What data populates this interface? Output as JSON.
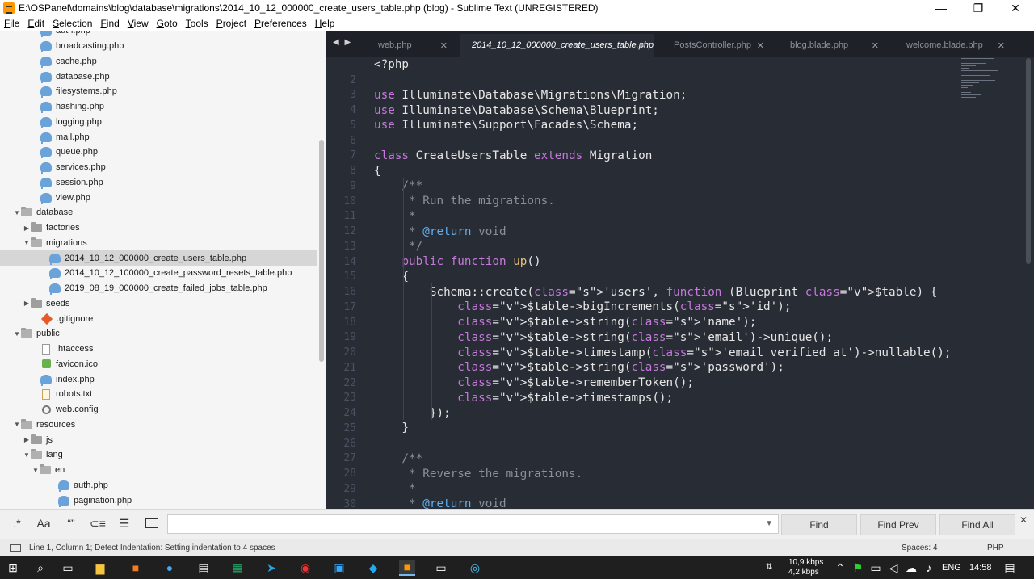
{
  "window": {
    "title": "E:\\OSPanel\\domains\\blog\\database\\migrations\\2014_10_12_000000_create_users_table.php (blog) - Sublime Text (UNREGISTERED)",
    "controls": [
      "—",
      "❐",
      "✕"
    ]
  },
  "menu": [
    "File",
    "Edit",
    "Selection",
    "Find",
    "View",
    "Goto",
    "Tools",
    "Project",
    "Preferences",
    "Help"
  ],
  "sidebar": {
    "items": [
      {
        "label": "auth.php",
        "icon": "php-file-icon",
        "level": 2
      },
      {
        "label": "broadcasting.php",
        "icon": "php-file-icon",
        "level": 2
      },
      {
        "label": "cache.php",
        "icon": "php-file-icon",
        "level": 2
      },
      {
        "label": "database.php",
        "icon": "php-file-icon",
        "level": 2
      },
      {
        "label": "filesystems.php",
        "icon": "php-file-icon",
        "level": 2
      },
      {
        "label": "hashing.php",
        "icon": "php-file-icon",
        "level": 2
      },
      {
        "label": "logging.php",
        "icon": "php-file-icon",
        "level": 2
      },
      {
        "label": "mail.php",
        "icon": "php-file-icon",
        "level": 2
      },
      {
        "label": "queue.php",
        "icon": "php-file-icon",
        "level": 2
      },
      {
        "label": "services.php",
        "icon": "php-file-icon",
        "level": 2
      },
      {
        "label": "session.php",
        "icon": "php-file-icon",
        "level": 2
      },
      {
        "label": "view.php",
        "icon": "php-file-icon",
        "level": 2
      },
      {
        "label": "database",
        "icon": "folder-open-icon",
        "level": 1
      },
      {
        "label": "factories",
        "icon": "folder-icon",
        "level": 2
      },
      {
        "label": "migrations",
        "icon": "folder-open-icon",
        "level": 2
      },
      {
        "label": "2014_10_12_000000_create_users_table.php",
        "icon": "php-file-icon",
        "level": 3,
        "selected": true
      },
      {
        "label": "2014_10_12_100000_create_password_resets_table.php",
        "icon": "php-file-icon",
        "level": 3
      },
      {
        "label": "2019_08_19_000000_create_failed_jobs_table.php",
        "icon": "php-file-icon",
        "level": 3
      },
      {
        "label": "seeds",
        "icon": "folder-icon",
        "level": 2
      },
      {
        "label": ".gitignore",
        "icon": "git-icon",
        "level": 2
      },
      {
        "label": "public",
        "icon": "folder-open-icon",
        "level": 1
      },
      {
        "label": ".htaccess",
        "icon": "file-icon",
        "level": 2
      },
      {
        "label": "favicon.ico",
        "icon": "image-icon",
        "level": 2
      },
      {
        "label": "index.php",
        "icon": "php-file-icon",
        "level": 2
      },
      {
        "label": "robots.txt",
        "icon": "text-file-icon",
        "level": 2
      },
      {
        "label": "web.config",
        "icon": "gear-icon",
        "level": 2
      },
      {
        "label": "resources",
        "icon": "folder-open-icon",
        "level": 1
      },
      {
        "label": "js",
        "icon": "folder-icon",
        "level": 2
      },
      {
        "label": "lang",
        "icon": "folder-open-icon",
        "level": 2
      },
      {
        "label": "en",
        "icon": "folder-open-icon",
        "level": 3
      },
      {
        "label": "auth.php",
        "icon": "php-file-icon",
        "level": 4
      },
      {
        "label": "pagination.php",
        "icon": "php-file-icon",
        "level": 4
      }
    ]
  },
  "tabs": [
    {
      "label": "web.php",
      "active": false
    },
    {
      "label": "2014_10_12_000000_create_users_table.php",
      "active": true
    },
    {
      "label": "PostsController.php",
      "active": false
    },
    {
      "label": "blog.blade.php",
      "active": false
    },
    {
      "label": "welcome.blade.php",
      "active": false
    }
  ],
  "code": {
    "lines": [
      {
        "n": "",
        "text": "<?php"
      },
      {
        "n": "2",
        "text": ""
      },
      {
        "n": "3",
        "text": "use Illuminate\\Database\\Migrations\\Migration;"
      },
      {
        "n": "4",
        "text": "use Illuminate\\Database\\Schema\\Blueprint;"
      },
      {
        "n": "5",
        "text": "use Illuminate\\Support\\Facades\\Schema;"
      },
      {
        "n": "6",
        "text": ""
      },
      {
        "n": "7",
        "text": "class CreateUsersTable extends Migration"
      },
      {
        "n": "8",
        "text": "{"
      },
      {
        "n": "9",
        "text": "    /**"
      },
      {
        "n": "10",
        "text": "     * Run the migrations."
      },
      {
        "n": "11",
        "text": "     *"
      },
      {
        "n": "12",
        "text": "     * @return void"
      },
      {
        "n": "13",
        "text": "     */"
      },
      {
        "n": "14",
        "text": "    public function up()"
      },
      {
        "n": "15",
        "text": "    {"
      },
      {
        "n": "16",
        "text": "        Schema::create('users', function (Blueprint $table) {"
      },
      {
        "n": "17",
        "text": "            $table->bigIncrements('id');"
      },
      {
        "n": "18",
        "text": "            $table->string('name');"
      },
      {
        "n": "19",
        "text": "            $table->string('email')->unique();"
      },
      {
        "n": "20",
        "text": "            $table->timestamp('email_verified_at')->nullable();"
      },
      {
        "n": "21",
        "text": "            $table->string('password');"
      },
      {
        "n": "22",
        "text": "            $table->rememberToken();"
      },
      {
        "n": "23",
        "text": "            $table->timestamps();"
      },
      {
        "n": "24",
        "text": "        });"
      },
      {
        "n": "25",
        "text": "    }"
      },
      {
        "n": "26",
        "text": ""
      },
      {
        "n": "27",
        "text": "    /**"
      },
      {
        "n": "28",
        "text": "     * Reverse the migrations."
      },
      {
        "n": "29",
        "text": "     *"
      },
      {
        "n": "30",
        "text": "     * @return void"
      }
    ]
  },
  "find": {
    "options": [
      ".*",
      "Aa",
      "“”",
      "⊂≡",
      "☰"
    ],
    "input_value": "",
    "buttons": [
      "Find",
      "Find Prev",
      "Find All"
    ]
  },
  "status": {
    "left": "Line 1, Column 1; Detect Indentation: Setting indentation to 4 spaces",
    "spaces": "Spaces: 4",
    "syntax": "PHP"
  },
  "taskbar": {
    "net_down": "10,9 kbps",
    "net_up": "4,2 kbps",
    "lang": "ENG",
    "time": "14:58"
  },
  "colors": {
    "editor_bg": "#282c34",
    "keyword": "#c678dd",
    "string": "#98c379",
    "variable": "#61afef",
    "comment": "#8a919c",
    "function": "#e5c07b"
  }
}
